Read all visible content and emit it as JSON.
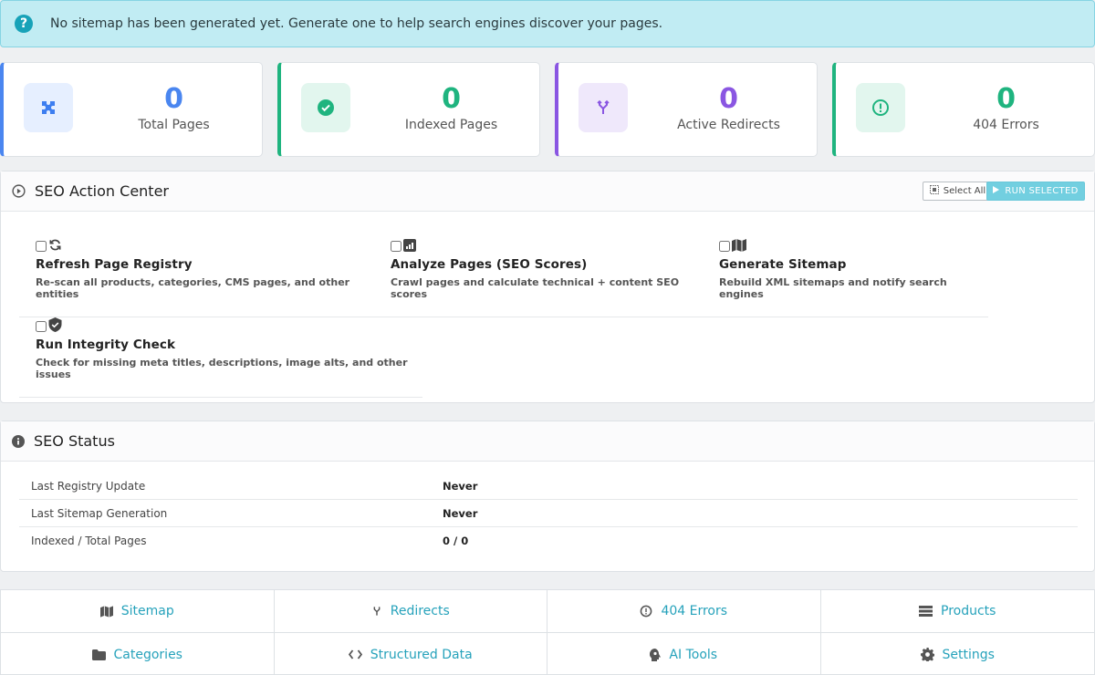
{
  "alert": {
    "text": "No sitemap has been generated yet. Generate one to help search engines discover your pages.",
    "icon": "question-circle-icon"
  },
  "stats": [
    {
      "value": "0",
      "label": "Total Pages",
      "color": "#4a86f0",
      "icon": "puzzle-icon"
    },
    {
      "value": "0",
      "label": "Indexed Pages",
      "color": "#1fb47f",
      "icon": "check-circle-icon"
    },
    {
      "value": "0",
      "label": "Active Redirects",
      "color": "#8a56e2",
      "icon": "fork-icon"
    },
    {
      "value": "0",
      "label": "404 Errors",
      "color": "#1fb47f",
      "icon": "exclamation-circle-icon"
    }
  ],
  "action_center": {
    "title": "SEO Action Center",
    "select_all_label": "Select All",
    "run_selected_label": "RUN SELECTED",
    "actions": [
      {
        "title": "Refresh Page Registry",
        "description": "Re-scan all products, categories, CMS pages, and other entities",
        "icon": "sync-icon"
      },
      {
        "title": "Analyze Pages (SEO Scores)",
        "description": "Crawl pages and calculate technical + content SEO scores",
        "icon": "chart-icon"
      },
      {
        "title": "Generate Sitemap",
        "description": "Rebuild XML sitemaps and notify search engines",
        "icon": "map-icon"
      },
      {
        "title": "Run Integrity Check",
        "description": "Check for missing meta titles, descriptions, image alts, and other issues",
        "icon": "shield-check-icon"
      }
    ]
  },
  "seo_status": {
    "title": "SEO Status",
    "rows": [
      {
        "key": "Last Registry Update",
        "value": "Never"
      },
      {
        "key": "Last Sitemap Generation",
        "value": "Never"
      },
      {
        "key": "Indexed / Total Pages",
        "value": "0 / 0"
      }
    ]
  },
  "nav": [
    {
      "label": "Sitemap",
      "icon": "map-icon"
    },
    {
      "label": "Redirects",
      "icon": "fork-icon"
    },
    {
      "label": "404 Errors",
      "icon": "exclamation-circle-icon"
    },
    {
      "label": "Products",
      "icon": "list-icon"
    },
    {
      "label": "Categories",
      "icon": "folder-icon"
    },
    {
      "label": "Structured Data",
      "icon": "code-icon"
    },
    {
      "label": "AI Tools",
      "icon": "brain-icon"
    },
    {
      "label": "Settings",
      "icon": "gear-icon"
    }
  ]
}
